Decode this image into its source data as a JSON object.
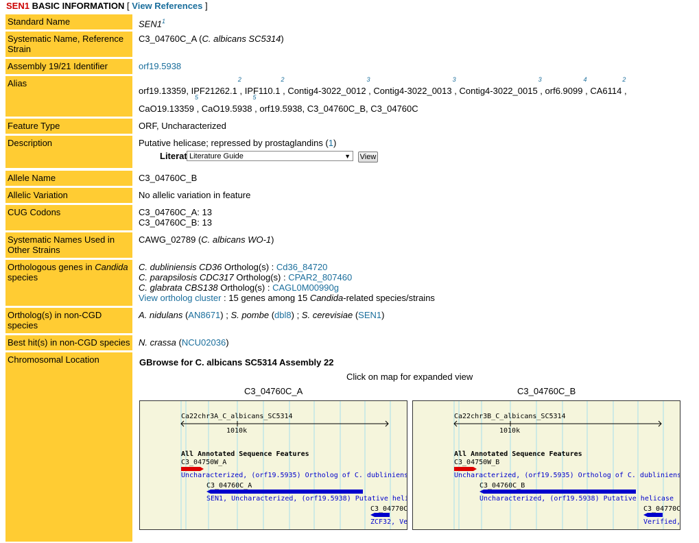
{
  "header": {
    "gene": "SEN1",
    "title": "BASIC INFORMATION",
    "bracket_open": "[",
    "view_references": "View References",
    "bracket_close": "]"
  },
  "rows": {
    "standard_name": {
      "label": "Standard Name",
      "value": "SEN1",
      "ref": "1"
    },
    "systematic_name": {
      "label": "Systematic Name, Reference Strain",
      "value": "C3_04760C_A (",
      "strain": "C. albicans SC5314",
      "close": ")"
    },
    "assembly": {
      "label": "Assembly 19/21 Identifier",
      "value": "orf19.5938"
    },
    "alias": {
      "label": "Alias",
      "line1": [
        {
          "text": "orf19.13359",
          "ref": ""
        },
        {
          "text": "IPF21262.1",
          "ref": "2"
        },
        {
          "text": "IPF110.1",
          "ref": "2"
        },
        {
          "text": "Contig4-3022_0012",
          "ref": "3"
        },
        {
          "text": "Contig4-3022_0013",
          "ref": "3"
        },
        {
          "text": "Contig4-3022_0015",
          "ref": "3"
        },
        {
          "text": "orf6.9099",
          "ref": "4"
        },
        {
          "text": "CA6114",
          "ref": "2"
        }
      ],
      "line2": [
        {
          "text": "CaO19.13359",
          "ref": "5"
        },
        {
          "text": "CaO19.5938",
          "ref": "5"
        },
        {
          "text": "orf19.5938, C3_04760C_B, C3_04760C",
          "ref": ""
        }
      ]
    },
    "feature_type": {
      "label": "Feature Type",
      "value": "ORF, Uncharacterized"
    },
    "description": {
      "label": "Description",
      "value": "Putative helicase; repressed by prostaglandins (",
      "ref_link": "1",
      "close": ")",
      "literature_label": "Literature",
      "literature_select": "Literature Guide",
      "view_button": "View"
    },
    "allele_name": {
      "label": "Allele Name",
      "value": "C3_04760C_B"
    },
    "allelic_variation": {
      "label": "Allelic Variation",
      "value": "No allelic variation in feature"
    },
    "cug_codons": {
      "label": "CUG Codons",
      "line1": "C3_04760C_A: 13",
      "line2": "C3_04760C_B: 13"
    },
    "other_strains": {
      "label": "Systematic Names Used in Other Strains",
      "value": "CAWG_02789 (",
      "strain": "C. albicans WO-1",
      "close": ")"
    },
    "orthologous": {
      "label_pre": "Orthologous genes in ",
      "label_italic": "Candida",
      "label_post": "species",
      "items": [
        {
          "species": "C. dubliniensis CD36",
          "mid": " Ortholog(s) : ",
          "link": "Cd36_84720"
        },
        {
          "species": "C. parapsilosis CDC317",
          "mid": " Ortholog(s) : ",
          "link": "CPAR2_807460"
        },
        {
          "species": "C. glabrata CBS138",
          "mid": " Ortholog(s) : ",
          "link": "CAGL0M00990g"
        }
      ],
      "cluster_link": "View ortholog cluster",
      "cluster_text": " : 15 genes among 15 ",
      "cluster_italic": "Candida",
      "cluster_end": "-related species/strains"
    },
    "non_cgd": {
      "label": "Ortholog(s) in non-CGD species",
      "s1": "A. nidulans",
      "l1": "AN8671",
      "s2": "S. pombe",
      "l2": "dbl8",
      "s3": "S. cerevisiae",
      "l3": "SEN1"
    },
    "best_hit": {
      "label": "Best hit(s) in non-CGD species",
      "species": "N. crassa",
      "link": "NCU02036"
    },
    "chromosomal": {
      "label": "Chromosomal Location",
      "gbrowse_title": "GBrowse for C. albicans SC5314 Assembly 22",
      "click_hint": "Click on map for expanded view",
      "panel_a": {
        "caption": "C3_04760C_A",
        "chrom": "Ca22chr3A_C_albicans_SC5314",
        "scale": "1010k",
        "track": "All Annotated Sequence Features",
        "f1_name": "C3_04750W_A",
        "f1_desc": "Uncharacterized, (orf19.5935) Ortholog of C. dubliniens",
        "f2_name": "C3_04760C_A",
        "f2_desc": "SEN1, Uncharacterized, (orf19.5938) Putative heli",
        "f3_name": "C3_04770C",
        "f3_desc": "ZCF32, Ve"
      },
      "panel_b": {
        "caption": "C3_04760C_B",
        "chrom": "Ca22chr3B_C_albicans_SC5314",
        "scale": "1010k",
        "track": "All Annotated Sequence Features",
        "f1_name": "C3_04750W_B",
        "f1_desc": "Uncharacterized, (orf19.5935) Ortholog of C. dubliniens",
        "f2_name": "C3_04760C_B",
        "f2_desc": "Uncharacterized, (orf19.5938) Putative helicase",
        "f3_name": "C3_04770C",
        "f3_desc": "Verified,"
      }
    }
  },
  "colors": {
    "label_bg": "#ffcc33",
    "link": "#1a6e9c",
    "gene_red": "#cc0000",
    "gbrowse_bg": "#f5f5dc",
    "feature_red": "#dd0000",
    "feature_blue": "#0000cc"
  }
}
